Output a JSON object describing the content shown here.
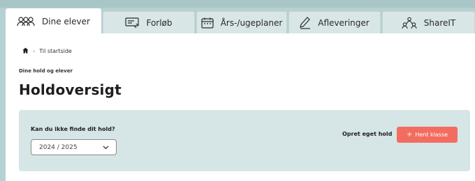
{
  "tabs": [
    {
      "label": "Dine elever",
      "icon": "students-icon",
      "active": true
    },
    {
      "label": "Forløb",
      "icon": "board-icon",
      "active": false
    },
    {
      "label": "Års-/ugeplaner",
      "icon": "calendar-icon",
      "active": false
    },
    {
      "label": "Afleveringer",
      "icon": "pen-icon",
      "active": false
    },
    {
      "label": "ShareIT",
      "icon": "share-people-icon",
      "active": false
    }
  ],
  "breadcrumb": {
    "home_icon": "home-icon",
    "separator": "›",
    "current": "Til startside"
  },
  "page": {
    "kicker": "Dine hold og elever",
    "title": "Holdoversigt"
  },
  "panel": {
    "label": "Kan du ikke finde dit hold?",
    "year_select": {
      "value": "2024 / 2025",
      "icon": "chevron-down-icon"
    },
    "create_link": "Opret eget hold",
    "fetch_button": {
      "icon": "plus-icon",
      "symbol": "+",
      "label": "Hent klasse"
    }
  },
  "colors": {
    "accent": "#f26d60",
    "panel": "#d6e5e5",
    "frame": "#b7d0d1"
  }
}
